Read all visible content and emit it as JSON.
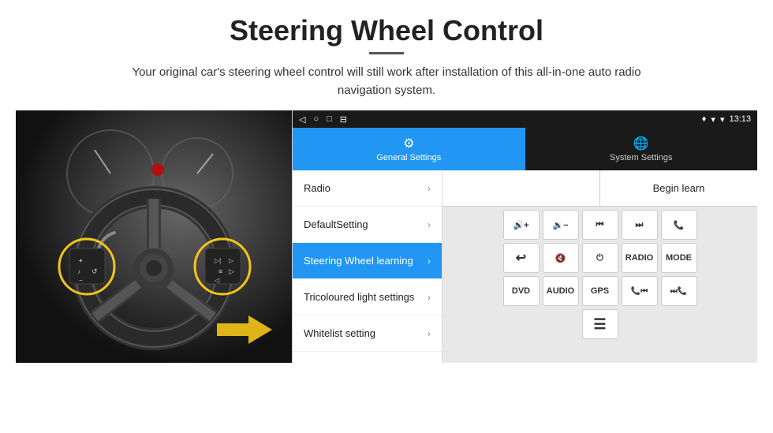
{
  "header": {
    "title": "Steering Wheel Control",
    "subtitle": "Your original car's steering wheel control will still work after installation of this all-in-one auto radio navigation system."
  },
  "status_bar": {
    "nav_back": "◁",
    "nav_home": "○",
    "nav_recent": "□",
    "nav_cast": "⊟",
    "wifi": "▾",
    "signal": "▾",
    "time": "13:13"
  },
  "tabs": [
    {
      "id": "general",
      "label": "General Settings",
      "icon": "⚙",
      "active": true
    },
    {
      "id": "system",
      "label": "System Settings",
      "icon": "🌐",
      "active": false
    }
  ],
  "menu_items": [
    {
      "id": "radio",
      "label": "Radio",
      "active": false
    },
    {
      "id": "default_setting",
      "label": "DefaultSetting",
      "active": false
    },
    {
      "id": "steering_wheel",
      "label": "Steering Wheel learning",
      "active": true
    },
    {
      "id": "tricoloured",
      "label": "Tricoloured light settings",
      "active": false
    },
    {
      "id": "whitelist",
      "label": "Whitelist setting",
      "active": false
    }
  ],
  "controls": {
    "begin_learn_label": "Begin learn",
    "rows": [
      [
        {
          "id": "vol_up",
          "label": "◀+",
          "type": "icon"
        },
        {
          "id": "vol_down",
          "label": "◀−",
          "type": "icon"
        },
        {
          "id": "prev",
          "label": "⏮",
          "type": "icon"
        },
        {
          "id": "next",
          "label": "⏭",
          "type": "icon"
        },
        {
          "id": "call",
          "label": "📞",
          "type": "icon"
        }
      ],
      [
        {
          "id": "hang_up",
          "label": "↩",
          "type": "icon"
        },
        {
          "id": "mute",
          "label": "◀×",
          "type": "icon"
        },
        {
          "id": "power",
          "label": "⏻",
          "type": "icon"
        },
        {
          "id": "radio_btn",
          "label": "RADIO",
          "type": "text"
        },
        {
          "id": "mode_btn",
          "label": "MODE",
          "type": "text"
        }
      ],
      [
        {
          "id": "dvd_btn",
          "label": "DVD",
          "type": "text"
        },
        {
          "id": "audio_btn",
          "label": "AUDIO",
          "type": "text"
        },
        {
          "id": "gps_btn",
          "label": "GPS",
          "type": "text"
        },
        {
          "id": "prev2",
          "label": "📞⏮",
          "type": "icon"
        },
        {
          "id": "next2",
          "label": "⏭📞",
          "type": "icon"
        }
      ],
      [
        {
          "id": "menu_icon",
          "label": "≡",
          "type": "icon"
        }
      ]
    ]
  }
}
